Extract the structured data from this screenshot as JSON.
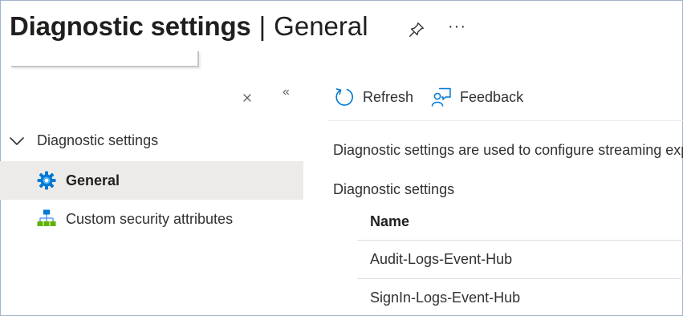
{
  "header": {
    "title": "Diagnostic settings",
    "separator": "|",
    "subtitle": "General",
    "more_label": "···",
    "pin_icon": "pin-icon"
  },
  "sidebar": {
    "close_icon": "close-icon",
    "collapse_label": "«",
    "group": {
      "label": "Diagnostic settings",
      "expanded": true,
      "icon": "chevron-down-icon"
    },
    "items": [
      {
        "label": "General",
        "icon": "gear-icon",
        "selected": true,
        "icon_color": "#0078d4"
      },
      {
        "label": "Custom security attributes",
        "icon": "hierarchy-icon",
        "selected": false,
        "icon_color": "#5ea0ef"
      }
    ]
  },
  "toolbar": {
    "refresh_label": "Refresh",
    "feedback_label": "Feedback",
    "accent": "#0078d4"
  },
  "main": {
    "description": "Diagnostic settings are used to configure streaming export of platform logs and metrics for a resource",
    "section_label": "Diagnostic settings",
    "table": {
      "columns": [
        "Name"
      ],
      "rows": [
        {
          "name": "Audit-Logs-Event-Hub"
        },
        {
          "name": "SignIn-Logs-Event-Hub"
        }
      ]
    }
  }
}
